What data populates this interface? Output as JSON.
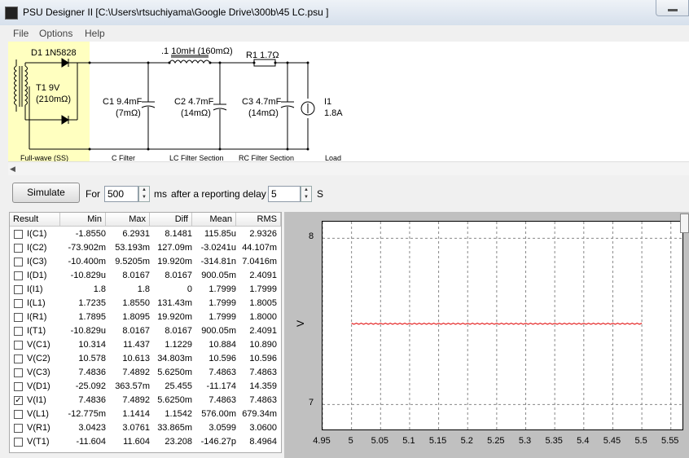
{
  "window": {
    "title": "PSU Designer II  [C:\\Users\\rtsuchiyama\\Google Drive\\300b\\45 LC.psu ]"
  },
  "menu": [
    "File",
    "Options",
    "Help"
  ],
  "schematic": {
    "d1": "D1 1N5828",
    "t1": "T1 9V",
    "t1_r": "(210mΩ)",
    "l1": ".1 10mH (160mΩ)",
    "r1": "R1 1.7Ω",
    "c1": "C1 9.4mF",
    "c1_r": "(7mΩ)",
    "c2": "C2 4.7mF",
    "c2_r": "(14mΩ)",
    "c3": "C3 4.7mF",
    "c3_r": "(14mΩ)",
    "i1": "I1",
    "i1_v": "1.8A",
    "sections": [
      "Full-wave (SS)",
      "C Filter",
      "LC Filter Section",
      "RC Filter Section",
      "Load"
    ]
  },
  "sim": {
    "simulate_label": "Simulate",
    "for_label": "For",
    "duration": "500",
    "ms_label": "ms",
    "delay_label": "after a reporting delay of",
    "delay": "5",
    "s_label": "S"
  },
  "table": {
    "headers": [
      "Result",
      "Min",
      "Max",
      "Diff",
      "Mean",
      "RMS"
    ],
    "rows": [
      {
        "name": "I(C1)",
        "checked": false,
        "min": "-1.8550",
        "max": "6.2931",
        "diff": "8.1481",
        "mean": "115.85u",
        "rms": "2.9326"
      },
      {
        "name": "I(C2)",
        "checked": false,
        "min": "-73.902m",
        "max": "53.193m",
        "diff": "127.09m",
        "mean": "-3.0241u",
        "rms": "44.107m"
      },
      {
        "name": "I(C3)",
        "checked": false,
        "min": "-10.400m",
        "max": "9.5205m",
        "diff": "19.920m",
        "mean": "-314.81n",
        "rms": "7.0416m"
      },
      {
        "name": "I(D1)",
        "checked": false,
        "min": "-10.829u",
        "max": "8.0167",
        "diff": "8.0167",
        "mean": "900.05m",
        "rms": "2.4091"
      },
      {
        "name": "I(I1)",
        "checked": false,
        "min": "1.8",
        "max": "1.8",
        "diff": "0",
        "mean": "1.7999",
        "rms": "1.7999"
      },
      {
        "name": "I(L1)",
        "checked": false,
        "min": "1.7235",
        "max": "1.8550",
        "diff": "131.43m",
        "mean": "1.7999",
        "rms": "1.8005"
      },
      {
        "name": "I(R1)",
        "checked": false,
        "min": "1.7895",
        "max": "1.8095",
        "diff": "19.920m",
        "mean": "1.7999",
        "rms": "1.8000"
      },
      {
        "name": "I(T1)",
        "checked": false,
        "min": "-10.829u",
        "max": "8.0167",
        "diff": "8.0167",
        "mean": "900.05m",
        "rms": "2.4091"
      },
      {
        "name": "V(C1)",
        "checked": false,
        "min": "10.314",
        "max": "11.437",
        "diff": "1.1229",
        "mean": "10.884",
        "rms": "10.890"
      },
      {
        "name": "V(C2)",
        "checked": false,
        "min": "10.578",
        "max": "10.613",
        "diff": "34.803m",
        "mean": "10.596",
        "rms": "10.596"
      },
      {
        "name": "V(C3)",
        "checked": false,
        "min": "7.4836",
        "max": "7.4892",
        "diff": "5.6250m",
        "mean": "7.4863",
        "rms": "7.4863"
      },
      {
        "name": "V(D1)",
        "checked": false,
        "min": "-25.092",
        "max": "363.57m",
        "diff": "25.455",
        "mean": "-11.174",
        "rms": "14.359"
      },
      {
        "name": "V(I1)",
        "checked": true,
        "min": "7.4836",
        "max": "7.4892",
        "diff": "5.6250m",
        "mean": "7.4863",
        "rms": "7.4863"
      },
      {
        "name": "V(L1)",
        "checked": false,
        "min": "-12.775m",
        "max": "1.1414",
        "diff": "1.1542",
        "mean": "576.00m",
        "rms": "679.34m"
      },
      {
        "name": "V(R1)",
        "checked": false,
        "min": "3.0423",
        "max": "3.0761",
        "diff": "33.865m",
        "mean": "3.0599",
        "rms": "3.0600"
      },
      {
        "name": "V(T1)",
        "checked": false,
        "min": "-11.604",
        "max": "11.604",
        "diff": "23.208",
        "mean": "-146.27p",
        "rms": "8.4964"
      }
    ]
  },
  "chart_data": {
    "type": "line",
    "title": "",
    "xlabel": "",
    "ylabel": "V",
    "xlim": [
      4.95,
      5.57
    ],
    "ylim": [
      6.85,
      8.1
    ],
    "x_ticks": [
      "4.95",
      "5",
      "5.05",
      "5.1",
      "5.15",
      "5.2",
      "5.25",
      "5.3",
      "5.35",
      "5.4",
      "5.45",
      "5.5",
      "5.55"
    ],
    "y_ticks": [
      "8",
      "7"
    ],
    "grid": true,
    "series": [
      {
        "color": "#e00000",
        "x_start": 5.0,
        "x_end": 5.5,
        "mean": 7.4863,
        "min": 7.4836,
        "max": 7.4892
      }
    ]
  },
  "colors": {
    "plot_bg": "#c0c0c0",
    "trace": "#e00000",
    "transformer_bg": "#ffffc0"
  }
}
